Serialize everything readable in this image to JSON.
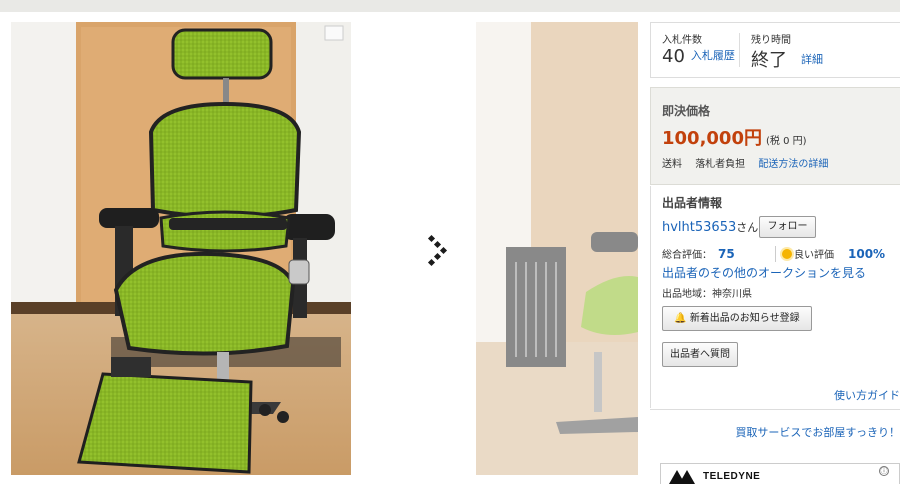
{
  "auction": {
    "bid_count_label": "入札件数",
    "bid_count": "40",
    "bid_history_link": "入札履歴",
    "time_left_label": "残り時間",
    "time_left": "終了",
    "details_link": "詳細"
  },
  "buy_now": {
    "label": "即決価格",
    "price": "100,000円",
    "tax_note": "(税 0 円)",
    "shipping_label": "送料",
    "shipping_value": "落札者負担",
    "shipping_link": "配送方法の詳細"
  },
  "seller": {
    "heading": "出品者情報",
    "name": "hvlht53653",
    "name_suffix": "さん",
    "follow_button": "フォロー",
    "total_rating_label": "総合評価：",
    "total_rating": "75",
    "good_rating_label": "良い評価",
    "good_rating_pct": "100%",
    "other_auctions_link": "出品者のその他のオークションを見る",
    "region": "出品地域：神奈川県",
    "notify_button": "新着出品のお知らせ登録",
    "ask_button": "出品者へ質問"
  },
  "links": {
    "usage_guide": "使い方ガイド",
    "promo": "買取サービスでお部屋すっきり！"
  },
  "ad": {
    "brand": "TELEDYNE",
    "info_icon": "ⓘ"
  },
  "icons": {
    "gallery_next": "chevron-right-icon",
    "bell": "bell-icon",
    "sun": "sun-icon"
  },
  "colors": {
    "link": "#1b64b8",
    "price": "#c2410c",
    "chair_green": "#8fbf2a"
  }
}
